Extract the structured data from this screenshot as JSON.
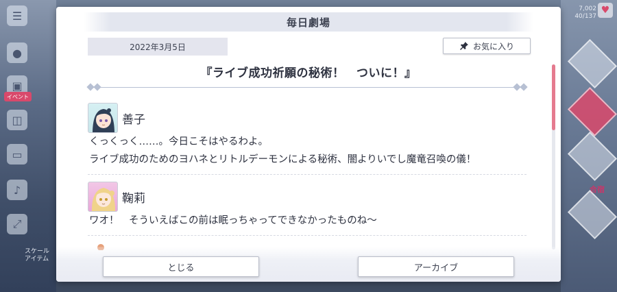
{
  "dialog": {
    "header_title": "毎日劇場",
    "date": "2022年3月5日",
    "favorite_label": "お気に入り",
    "story_title": "『ライブ成功祈願の秘術！　ついに！』"
  },
  "entries": [
    {
      "speaker": "善子",
      "lines": [
        "くっくっく……。今日こそはやるわよ。",
        "ライブ成功のためのヨハネとリトルデーモンによる秘術、闇よりいでし魔竜召喚の儀！"
      ]
    },
    {
      "speaker": "鞠莉",
      "lines": [
        "ワオ！　そういえばこの前は眠っちゃってできなかったものね〜"
      ]
    }
  ],
  "footer": {
    "close_label": "とじる",
    "archive_label": "アーカイブ"
  },
  "background": {
    "side_badge": "イベント",
    "side_small": "スケール\nアイテム",
    "right_top": "7,002\n40/137",
    "right_label": "合宿"
  },
  "colors": {
    "accent_pink": "#e57b8f",
    "header_band": "#e3e6ef",
    "text": "#2e3240"
  }
}
